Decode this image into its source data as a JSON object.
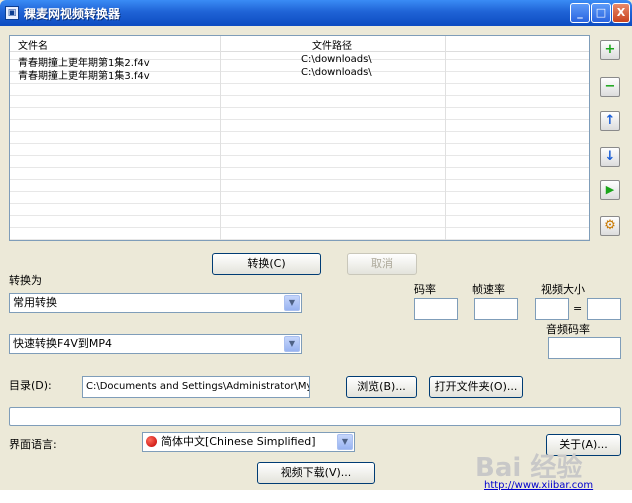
{
  "window": {
    "title": "稞麦网视频转换器",
    "app_icon": "app-icon",
    "min": "_",
    "max": "□",
    "close": "X"
  },
  "filelist": {
    "columns": [
      "文件名",
      "文件路径"
    ],
    "rows": [
      {
        "name": "青春期撞上更年期第1集2.f4v",
        "path": "C:\\downloads\\"
      },
      {
        "name": "青春期撞上更年期第1集3.f4v",
        "path": "C:\\downloads\\"
      }
    ]
  },
  "side_buttons": [
    {
      "icon": "add-icon",
      "glyph": "+",
      "color": "#1aa51a"
    },
    {
      "icon": "remove-icon",
      "glyph": "−",
      "color": "#1aa51a"
    },
    {
      "icon": "arrow-up-icon",
      "glyph": "↑",
      "color": "#1c5fd6"
    },
    {
      "icon": "arrow-down-icon",
      "glyph": "↓",
      "color": "#1c5fd6"
    },
    {
      "icon": "play-icon",
      "glyph": "▶",
      "color": "#1aa51a"
    },
    {
      "icon": "settings-icon",
      "glyph": "⚙",
      "color": "#c87800"
    }
  ],
  "actions": {
    "convert": "转换(C)",
    "cancel": "取消"
  },
  "convert_to": {
    "label": "转换为",
    "category": "常用转换",
    "preset": "快速转换F4V到MP4"
  },
  "params": {
    "bitrate_label": "码率",
    "framerate_label": "帧速率",
    "video_size_label": "视频大小",
    "size_separator": "=",
    "audio_bitrate_label": "音频码率"
  },
  "directory": {
    "label": "目录(D):",
    "value": "C:\\Documents and Settings\\Administrator\\My Docu",
    "browse": "浏览(B)...",
    "open_folder": "打开文件夹(O)..."
  },
  "language": {
    "label": "界面语言:",
    "value": "简体中文[Chinese Simplified]"
  },
  "about": "关于(A)...",
  "video_download": "视频下载(V)...",
  "website": "http://www.xiibar.com",
  "watermark": "Bai 经验",
  "colors": {
    "title_blue": "#0d4cc1",
    "border": "#7f9db9",
    "face": "#ece9d8"
  }
}
